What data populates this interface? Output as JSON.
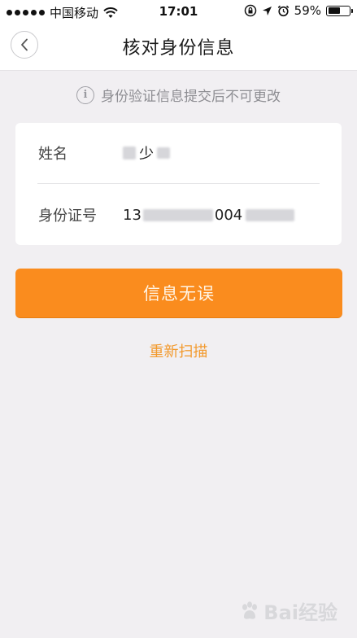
{
  "status_bar": {
    "carrier": "中国移动",
    "time": "17:01",
    "battery_percent": "59%",
    "battery_level": 0.59
  },
  "nav": {
    "title": "核对身份信息"
  },
  "notice": {
    "text": "身份验证信息提交后不可更改"
  },
  "form": {
    "name_label": "姓名",
    "name_value_visible": "少",
    "id_label": "身份证号",
    "id_value_prefix": "13",
    "id_value_middle": "004"
  },
  "actions": {
    "confirm_label": "信息无误",
    "rescan_label": "重新扫描"
  },
  "watermark": {
    "text": "Bai经验"
  },
  "colors": {
    "accent": "#fa8c1e",
    "link": "#f29a2e",
    "background": "#f1eff2"
  }
}
